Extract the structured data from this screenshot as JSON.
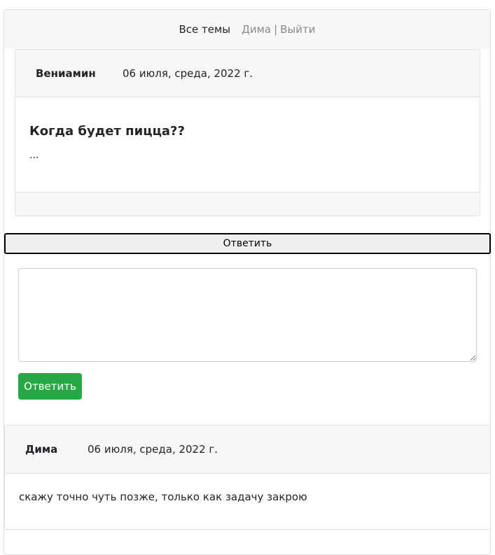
{
  "nav": {
    "all_topics": "Все темы",
    "user": "Дима",
    "separator": "|",
    "logout": "Выйти"
  },
  "topic": {
    "author": "Вениамин",
    "date": "06 июля, среда, 2022 г.",
    "title": "Когда будет пицца??",
    "text": "..."
  },
  "reply_form": {
    "toggle_label": "Ответить",
    "textarea_value": "",
    "submit_label": "Ответить",
    "submit_color": "#28a745"
  },
  "replies": [
    {
      "author": "Дима",
      "date": "06 июля, среда, 2022 г.",
      "text": "скажу точно чуть позже, только как задачу закрою"
    }
  ]
}
